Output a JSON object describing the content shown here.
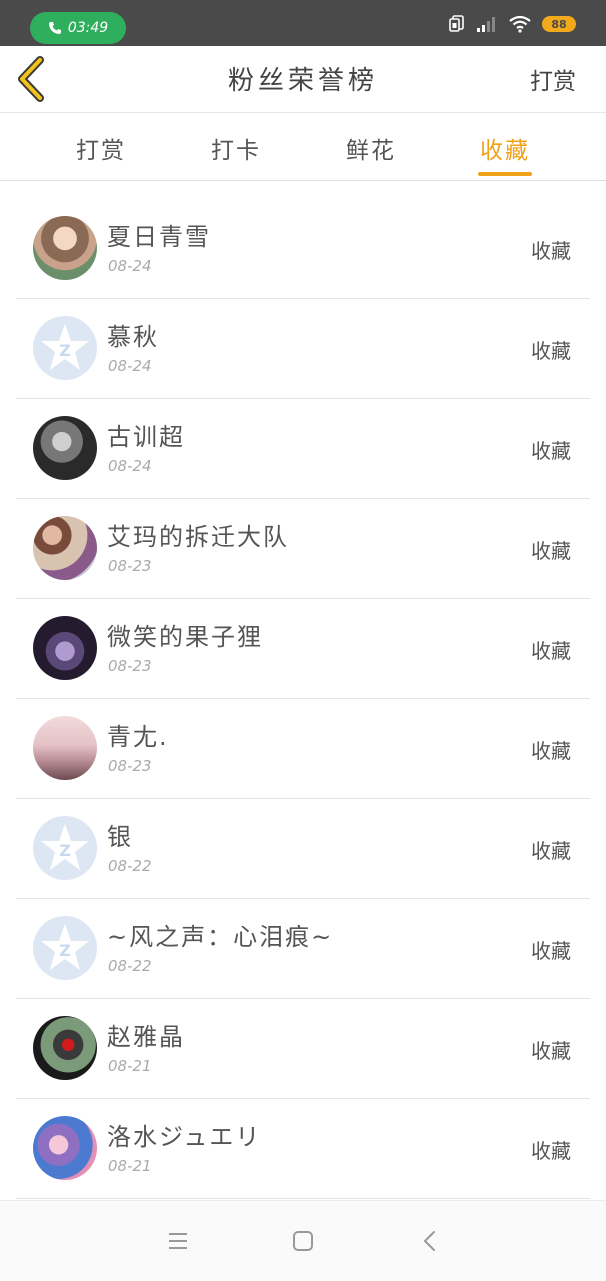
{
  "status_bar": {
    "time": "03:49",
    "battery": "88"
  },
  "header": {
    "title": "粉丝荣誉榜",
    "action": "打赏"
  },
  "tabs": [
    {
      "label": "打赏",
      "active": false
    },
    {
      "label": "打卡",
      "active": false
    },
    {
      "label": "鲜花",
      "active": false
    },
    {
      "label": "收藏",
      "active": true
    }
  ],
  "accent_color": "#f0a21a",
  "fans": [
    {
      "name": "夏日青雪",
      "date": "08-24",
      "action": "收藏",
      "avatar": "photo-anime-girl"
    },
    {
      "name": "慕秋",
      "date": "08-24",
      "action": "收藏",
      "avatar": "qq-default-icon"
    },
    {
      "name": "古训超",
      "date": "08-24",
      "action": "收藏",
      "avatar": "photo-portrait-bw"
    },
    {
      "name": "艾玛的拆迁大队",
      "date": "08-23",
      "action": "收藏",
      "avatar": "photo-anime-group"
    },
    {
      "name": "微笑的果子狸",
      "date": "08-23",
      "action": "收藏",
      "avatar": "photo-dark-purple"
    },
    {
      "name": "青尢.",
      "date": "08-23",
      "action": "收藏",
      "avatar": "photo-cherry-blossom"
    },
    {
      "name": "银",
      "date": "08-22",
      "action": "收藏",
      "avatar": "qq-default-icon"
    },
    {
      "name": "~风之声：心泪痕~",
      "date": "08-22",
      "action": "收藏",
      "avatar": "qq-default-icon"
    },
    {
      "name": "赵雅晶",
      "date": "08-21",
      "action": "收藏",
      "avatar": "photo-red-rose"
    },
    {
      "name": "洛水ジュエリ",
      "date": "08-21",
      "action": "收藏",
      "avatar": "photo-anime-twins"
    }
  ]
}
